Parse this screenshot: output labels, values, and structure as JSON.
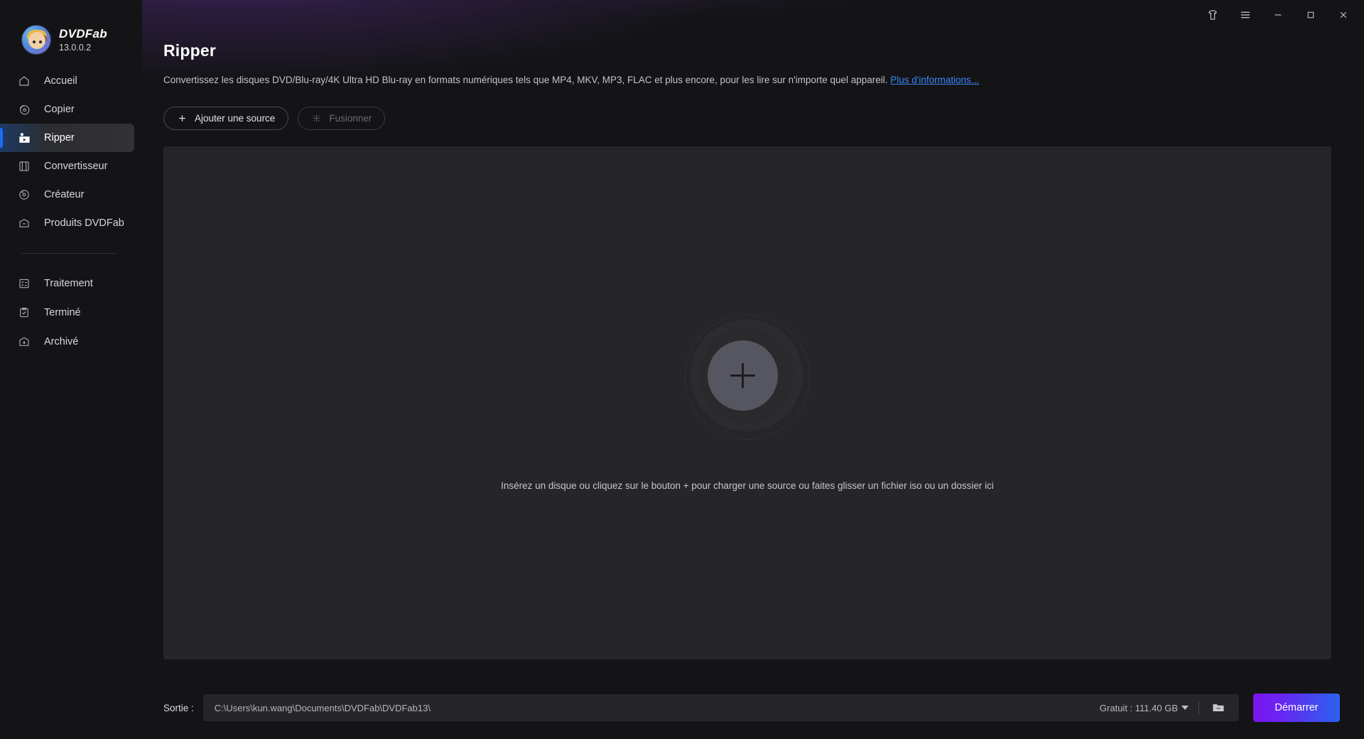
{
  "brand": {
    "name": "DVDFab",
    "version": "13.0.0.2",
    "logo_icon": "dvdfab-mascot-icon"
  },
  "titlebar": {
    "buttons": [
      {
        "name": "theme-icon",
        "label": ""
      },
      {
        "name": "menu-icon",
        "label": ""
      },
      {
        "name": "minimize-icon",
        "label": ""
      },
      {
        "name": "maximize-icon",
        "label": ""
      },
      {
        "name": "close-icon",
        "label": ""
      }
    ]
  },
  "sidebar": {
    "primary_items": [
      {
        "label": "Accueil",
        "icon": "home-icon",
        "active": false
      },
      {
        "label": "Copier",
        "icon": "copy-disc-icon",
        "active": false
      },
      {
        "label": "Ripper",
        "icon": "ripper-icon",
        "active": true
      },
      {
        "label": "Convertisseur",
        "icon": "film-icon",
        "active": false
      },
      {
        "label": "Créateur",
        "icon": "disc-icon",
        "active": false
      },
      {
        "label": "Produits DVDFab",
        "icon": "box-icon",
        "active": false
      }
    ],
    "secondary_items": [
      {
        "label": "Traitement",
        "icon": "task-list-icon",
        "active": false
      },
      {
        "label": "Terminé",
        "icon": "clipboard-check-icon",
        "active": false
      },
      {
        "label": "Archivé",
        "icon": "archive-icon",
        "active": false
      }
    ]
  },
  "page": {
    "title": "Ripper",
    "description_before_link": "Convertissez les disques DVD/Blu-ray/4K Ultra HD Blu-ray en formats numériques tels que MP4, MKV, MP3, FLAC et plus encore, pour les lire sur n'importe quel appareil. ",
    "description_link": "Plus d'informations..."
  },
  "actions": {
    "add_source_label": "Ajouter une source",
    "add_source_icon": "plus-icon",
    "merge_label": "Fusionner",
    "merge_icon": "merge-icon",
    "merge_disabled": true
  },
  "dropzone": {
    "add_button_icon": "plus-circle-icon",
    "hint": "Insérez un disque ou cliquez sur le bouton +  pour charger une source ou faites glisser un fichier iso ou un dossier ici"
  },
  "output": {
    "label": "Sortie :",
    "path": "C:\\Users\\kun.wang\\Documents\\DVDFab\\DVDFab13\\",
    "free_space": "Gratuit : 111.40 GB",
    "folder_icon": "folder-icon",
    "start_label": "Démarrer"
  },
  "colors": {
    "accent_blue": "#1a6ef5",
    "link_blue": "#3a86f7",
    "start_gradient_from": "#7b15f0",
    "start_gradient_to": "#2a62ef",
    "panel_bg": "#262628",
    "app_bg": "#141416",
    "hero_purple": "#6e38aa"
  }
}
